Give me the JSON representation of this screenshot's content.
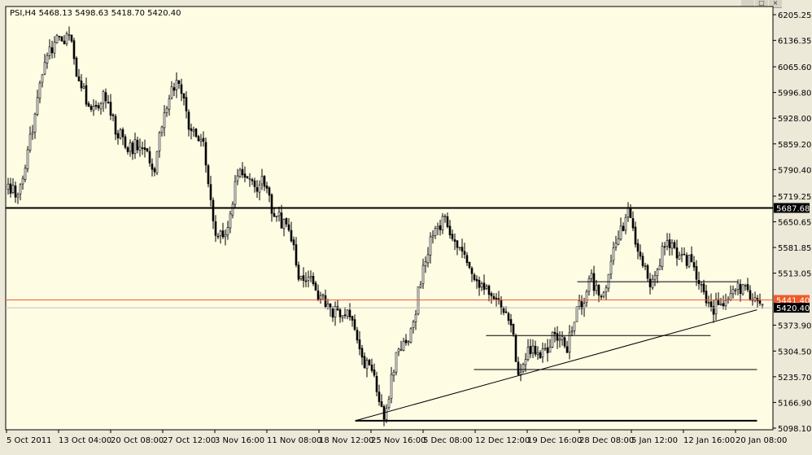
{
  "window": {
    "controls": {
      "minimize": "_",
      "restore": "□",
      "close": "×"
    }
  },
  "chart_data": {
    "type": "candlestick",
    "symbol_info": "PSI,H4  5468.13 5498.63 5418.70 5420.40",
    "price_ticks": [
      6205.25,
      6136.35,
      6065.6,
      5996.8,
      5928.0,
      5859.2,
      5790.4,
      5719.25,
      5650.65,
      5581.85,
      5513.05,
      5373.9,
      5304.5,
      5235.7,
      5166.9,
      5098.1
    ],
    "time_ticks": [
      "5 Oct 2011",
      "13 Oct 04:00",
      "20 Oct 08:00",
      "27 Oct 12:00",
      "3 Nov 16:00",
      "11 Nov 08:00",
      "18 Nov 12:00",
      "25 Nov 16:00",
      "5 Dec 08:00",
      "12 Dec 12:00",
      "19 Dec 16:00",
      "28 Dec 08:00",
      "5 Jan 12:00",
      "12 Jan 16:00",
      "20 Jan 08:00"
    ],
    "ylim": [
      5098.1,
      6205.25
    ],
    "current_price": {
      "value": 5420.4,
      "label": "5420.40",
      "color": "#000000"
    },
    "levels": [
      {
        "value": 5687.68,
        "label": "5687.68",
        "color": "#000000",
        "full": true
      },
      {
        "value": 5441.4,
        "label": "5441.40",
        "color": "#f05a28",
        "full": true
      }
    ],
    "segments": [
      {
        "name": "support-line-5490",
        "x1": "28 Dec 00:00",
        "y1": 5490,
        "x2": "20 Jan 16:00",
        "y2": 5490
      },
      {
        "name": "support-line-5346",
        "x1": "14 Dec 00:00",
        "y1": 5346,
        "x2": "16 Jan 16:00",
        "y2": 5346
      },
      {
        "name": "support-line-5255",
        "x1": "12 Dec 08:00",
        "y1": 5255,
        "x2": "23 Jan 12:00",
        "y2": 5255
      },
      {
        "name": "support-line-5118",
        "x1": "23 Nov 12:00",
        "y1": 5118,
        "x2": "23 Jan 12:00",
        "y2": 5118
      },
      {
        "name": "trendline",
        "x1": "23 Nov 12:00",
        "y1": 5118,
        "x2": "23 Jan 12:00",
        "y2": 5415
      }
    ],
    "anchors": {
      "start_price": 5740
    },
    "waypoints": [
      [
        5650,
        5750
      ],
      [
        5780,
        5900
      ],
      [
        5960,
        6090
      ],
      [
        6000,
        6140
      ],
      [
        6080,
        6150
      ],
      [
        6050,
        6010
      ],
      [
        5980,
        5950
      ],
      [
        5930,
        5990
      ],
      [
        5940,
        5890
      ],
      [
        5880,
        5850
      ],
      [
        5830,
        5860
      ],
      [
        5810,
        5780
      ],
      [
        5900,
        5960
      ],
      [
        5985,
        6040
      ],
      [
        5935,
        5890
      ],
      [
        5870,
        5880
      ],
      [
        5860,
        5620
      ],
      [
        5560,
        5640
      ],
      [
        5700,
        5780
      ],
      [
        5840,
        5740
      ],
      [
        5720,
        5760
      ],
      [
        5700,
        5670
      ],
      [
        5630,
        5640
      ],
      [
        5560,
        5510
      ],
      [
        5580,
        5470
      ],
      [
        5520,
        5440
      ],
      [
        5440,
        5400
      ],
      [
        5380,
        5410
      ],
      [
        5340,
        5300
      ],
      [
        5260,
        5235
      ],
      [
        5180,
        5140
      ],
      [
        5160,
        5310
      ],
      [
        5360,
        5330
      ],
      [
        5380,
        5500
      ],
      [
        5550,
        5620
      ],
      [
        5690,
        5660
      ],
      [
        5620,
        5580
      ],
      [
        5610,
        5520
      ],
      [
        5460,
        5490
      ],
      [
        5560,
        5430
      ],
      [
        5380,
        5430
      ],
      [
        5340,
        5260
      ],
      [
        5280,
        5310
      ],
      [
        5340,
        5290
      ],
      [
        5310,
        5350
      ],
      [
        5280,
        5330
      ],
      [
        5390,
        5420
      ],
      [
        5470,
        5490
      ],
      [
        5440,
        5470
      ],
      [
        5480,
        5600
      ],
      [
        5660,
        5670
      ],
      [
        5590,
        5560
      ],
      [
        5540,
        5480
      ],
      [
        5510,
        5590
      ],
      [
        5560,
        5570
      ],
      [
        5510,
        5560
      ],
      [
        5540,
        5470
      ],
      [
        5440,
        5420
      ],
      [
        5410,
        5450
      ],
      [
        5450,
        5470
      ],
      [
        5490,
        5455
      ],
      [
        5475,
        5420
      ]
    ],
    "step": 18,
    "seed": 97,
    "colors": {
      "bull": "#ffffff",
      "bear": "#000000",
      "wick": "#000000",
      "background": "#fffce4"
    }
  }
}
